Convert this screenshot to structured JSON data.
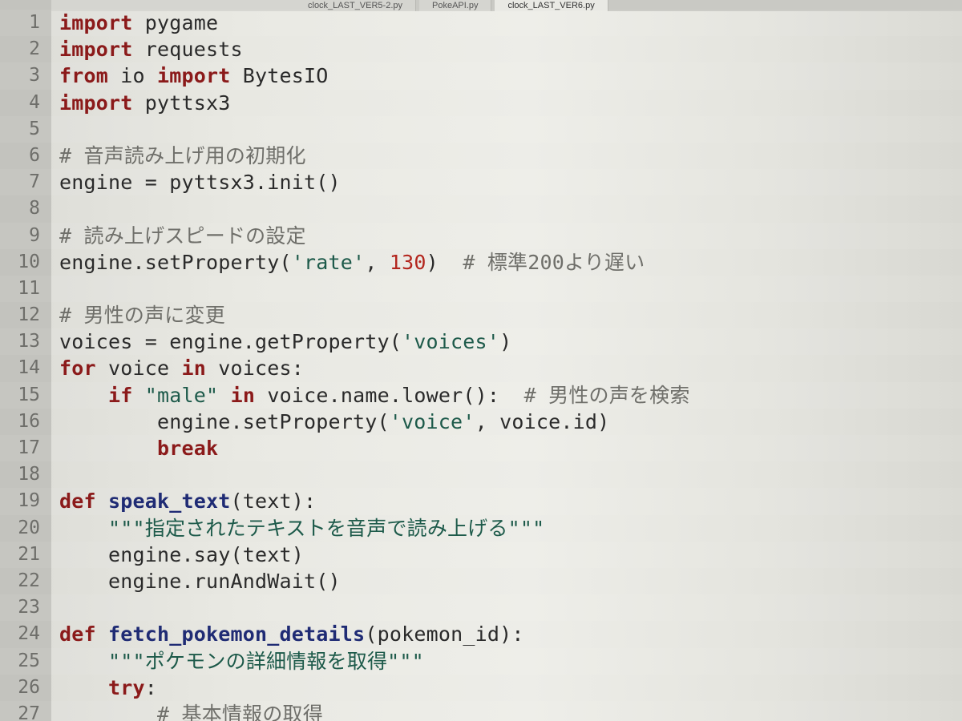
{
  "tabs": [
    {
      "label": "clock_LAST_VER5-2.py",
      "active": false
    },
    {
      "label": "PokeAPI.py",
      "active": false
    },
    {
      "label": "clock_LAST_VER6.py",
      "active": true
    }
  ],
  "code_lines": [
    {
      "number": "1",
      "indent": 0,
      "tokens": [
        {
          "t": "import",
          "c": "kw"
        },
        {
          "t": " pygame",
          "c": ""
        }
      ]
    },
    {
      "number": "2",
      "indent": 0,
      "tokens": [
        {
          "t": "import",
          "c": "kw"
        },
        {
          "t": " requests",
          "c": ""
        }
      ]
    },
    {
      "number": "3",
      "indent": 0,
      "tokens": [
        {
          "t": "from",
          "c": "kw"
        },
        {
          "t": " io ",
          "c": ""
        },
        {
          "t": "import",
          "c": "kw"
        },
        {
          "t": " BytesIO",
          "c": ""
        }
      ]
    },
    {
      "number": "4",
      "indent": 0,
      "tokens": [
        {
          "t": "import",
          "c": "kw"
        },
        {
          "t": " pyttsx3",
          "c": ""
        }
      ]
    },
    {
      "number": "5",
      "indent": 0,
      "tokens": []
    },
    {
      "number": "6",
      "indent": 0,
      "tokens": [
        {
          "t": "# 音声読み上げ用の初期化",
          "c": "com"
        }
      ]
    },
    {
      "number": "7",
      "indent": 0,
      "tokens": [
        {
          "t": "engine = pyttsx3.init()",
          "c": ""
        }
      ]
    },
    {
      "number": "8",
      "indent": 0,
      "tokens": []
    },
    {
      "number": "9",
      "indent": 0,
      "tokens": [
        {
          "t": "# 読み上げスピードの設定",
          "c": "com"
        }
      ]
    },
    {
      "number": "10",
      "indent": 0,
      "tokens": [
        {
          "t": "engine.setProperty(",
          "c": ""
        },
        {
          "t": "'rate'",
          "c": "str"
        },
        {
          "t": ", ",
          "c": ""
        },
        {
          "t": "130",
          "c": "num"
        },
        {
          "t": ")  ",
          "c": ""
        },
        {
          "t": "# 標準200より遅い",
          "c": "com"
        }
      ]
    },
    {
      "number": "11",
      "indent": 0,
      "tokens": []
    },
    {
      "number": "12",
      "indent": 0,
      "tokens": [
        {
          "t": "# 男性の声に変更",
          "c": "com"
        }
      ]
    },
    {
      "number": "13",
      "indent": 0,
      "tokens": [
        {
          "t": "voices = engine.getProperty(",
          "c": ""
        },
        {
          "t": "'voices'",
          "c": "str"
        },
        {
          "t": ")",
          "c": ""
        }
      ]
    },
    {
      "number": "14",
      "indent": 0,
      "tokens": [
        {
          "t": "for",
          "c": "kw"
        },
        {
          "t": " voice ",
          "c": ""
        },
        {
          "t": "in",
          "c": "kw"
        },
        {
          "t": " voices:",
          "c": ""
        }
      ]
    },
    {
      "number": "15",
      "indent": 1,
      "tokens": [
        {
          "t": "if",
          "c": "kw"
        },
        {
          "t": " ",
          "c": ""
        },
        {
          "t": "\"male\"",
          "c": "str"
        },
        {
          "t": " ",
          "c": ""
        },
        {
          "t": "in",
          "c": "kw"
        },
        {
          "t": " voice.name.lower():  ",
          "c": ""
        },
        {
          "t": "# 男性の声を検索",
          "c": "com"
        }
      ]
    },
    {
      "number": "16",
      "indent": 2,
      "tokens": [
        {
          "t": "engine.setProperty(",
          "c": ""
        },
        {
          "t": "'voice'",
          "c": "str"
        },
        {
          "t": ", voice.id)",
          "c": ""
        }
      ]
    },
    {
      "number": "17",
      "indent": 2,
      "tokens": [
        {
          "t": "break",
          "c": "kw"
        }
      ]
    },
    {
      "number": "18",
      "indent": 0,
      "tokens": []
    },
    {
      "number": "19",
      "indent": 0,
      "tokens": [
        {
          "t": "def",
          "c": "kw"
        },
        {
          "t": " ",
          "c": ""
        },
        {
          "t": "speak_text",
          "c": "fn"
        },
        {
          "t": "(text):",
          "c": ""
        }
      ]
    },
    {
      "number": "20",
      "indent": 1,
      "tokens": [
        {
          "t": "\"\"\"指定されたテキストを音声で読み上げる\"\"\"",
          "c": "str"
        }
      ]
    },
    {
      "number": "21",
      "indent": 1,
      "tokens": [
        {
          "t": "engine.say(text)",
          "c": ""
        }
      ]
    },
    {
      "number": "22",
      "indent": 1,
      "tokens": [
        {
          "t": "engine.runAndWait()",
          "c": ""
        }
      ]
    },
    {
      "number": "23",
      "indent": 0,
      "tokens": []
    },
    {
      "number": "24",
      "indent": 0,
      "tokens": [
        {
          "t": "def",
          "c": "kw"
        },
        {
          "t": " ",
          "c": ""
        },
        {
          "t": "fetch_pokemon_details",
          "c": "fn"
        },
        {
          "t": "(pokemon_id):",
          "c": ""
        }
      ]
    },
    {
      "number": "25",
      "indent": 1,
      "tokens": [
        {
          "t": "\"\"\"ポケモンの詳細情報を取得\"\"\"",
          "c": "str"
        }
      ]
    },
    {
      "number": "26",
      "indent": 1,
      "tokens": [
        {
          "t": "try",
          "c": "kw"
        },
        {
          "t": ":",
          "c": ""
        }
      ]
    },
    {
      "number": "27",
      "indent": 2,
      "tokens": [
        {
          "t": "# 基本情報の取得",
          "c": "com"
        }
      ]
    }
  ]
}
